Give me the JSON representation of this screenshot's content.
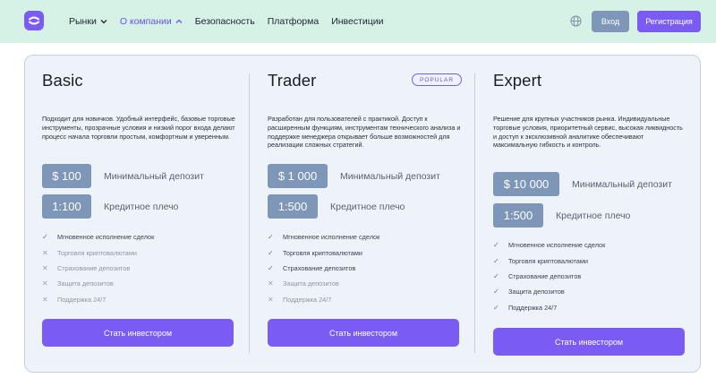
{
  "nav": {
    "items": [
      {
        "label": "Рынки",
        "has_dropdown": true,
        "active": false
      },
      {
        "label": "О компании",
        "has_dropdown": true,
        "active": true
      },
      {
        "label": "Безопасность",
        "has_dropdown": false,
        "active": false
      },
      {
        "label": "Платформа",
        "has_dropdown": false,
        "active": false
      },
      {
        "label": "Инвестиции",
        "has_dropdown": false,
        "active": false
      }
    ],
    "login_label": "Вход",
    "register_label": "Регистрация",
    "globe_icon": "globe-icon"
  },
  "colors": {
    "accent": "#7a5cf5",
    "pill": "#7e96b8",
    "header_bg": "#d6f2e7",
    "panel_bg": "#eef3fa"
  },
  "plans": [
    {
      "title": "Basic",
      "badge": "",
      "description": "Подходит для новичков. Удобный интерфейс, базовые торговые инструменты, прозрачные условия и низкий порог входа делают процесс начала торговли простым, комфортным и уверенным.",
      "deposit_value": "$ 100",
      "deposit_label": "Минимальный депозит",
      "leverage_value": "1:100",
      "leverage_label": "Кредитное плечо",
      "features": [
        {
          "label": "Мгновенное исполнение сделок",
          "included": true
        },
        {
          "label": "Торговля криптовалютами",
          "included": false
        },
        {
          "label": "Страхование депозитов",
          "included": false
        },
        {
          "label": "Защита депозитов",
          "included": false
        },
        {
          "label": "Поддержка 24/7",
          "included": false
        }
      ],
      "cta_label": "Стать инвестором"
    },
    {
      "title": "Trader",
      "badge": "POPULAR",
      "description": "Разработан для пользователей с практикой. Доступ к расширенным функциям, инструментам технического анализа и поддержке менеджера открывает больше возможностей для реализации сложных стратегий.",
      "deposit_value": "$ 1 000",
      "deposit_label": "Минимальный депозит",
      "leverage_value": "1:500",
      "leverage_label": "Кредитное плечо",
      "features": [
        {
          "label": "Мгновенное исполнение сделок",
          "included": true
        },
        {
          "label": "Торговля криптовалютами",
          "included": true
        },
        {
          "label": "Страхование депозитов",
          "included": true
        },
        {
          "label": "Защита депозитов",
          "included": false
        },
        {
          "label": "Поддержка 24/7",
          "included": false
        }
      ],
      "cta_label": "Стать инвестором"
    },
    {
      "title": "Expert",
      "badge": "",
      "description": "Решение для крупных участников рынка. Индивидуальные торговые условия, приоритетный сервис, высокая ликвидность и доступ к эксклюзивной аналитике обеспечивают максимальную гибкость и контроль.",
      "deposit_value": "$ 10 000",
      "deposit_label": "Минимальный депозит",
      "leverage_value": "1:500",
      "leverage_label": "Кредитное плечо",
      "features": [
        {
          "label": "Мгновенное исполнение сделок",
          "included": true
        },
        {
          "label": "Торговля криптовалютами",
          "included": true
        },
        {
          "label": "Страхование депозитов",
          "included": true
        },
        {
          "label": "Защита депозитов",
          "included": true
        },
        {
          "label": "Поддержка 24/7",
          "included": true
        }
      ],
      "cta_label": "Стать инвестором"
    }
  ]
}
